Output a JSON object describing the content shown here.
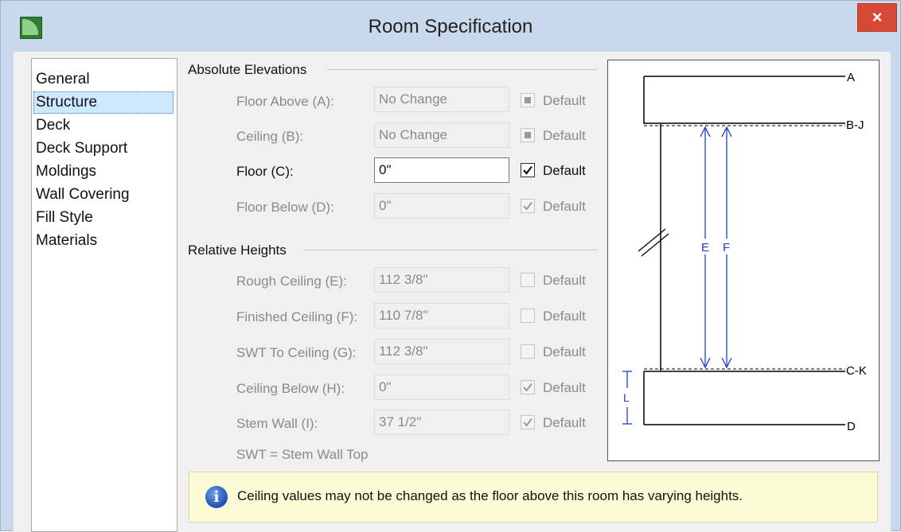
{
  "window": {
    "title": "Room Specification",
    "close_label": "×"
  },
  "nav": {
    "items": [
      "General",
      "Structure",
      "Deck",
      "Deck Support",
      "Moldings",
      "Wall Covering",
      "Fill Style",
      "Materials"
    ],
    "selected_index": 1
  },
  "absolute": {
    "header": "Absolute Elevations",
    "rows": [
      {
        "label": "Floor Above (A):",
        "value": "No Change",
        "default_label": "Default",
        "checkbox": "indeterminate",
        "enabled": false
      },
      {
        "label": "Ceiling (B):",
        "value": "No Change",
        "default_label": "Default",
        "checkbox": "indeterminate",
        "enabled": false
      },
      {
        "label": "Floor (C):",
        "value": "0\"",
        "default_label": "Default",
        "checkbox": "checked",
        "enabled": true
      },
      {
        "label": "Floor Below (D):",
        "value": "0\"",
        "default_label": "Default",
        "checkbox": "checked",
        "enabled": false
      }
    ]
  },
  "relative": {
    "header": "Relative Heights",
    "rows": [
      {
        "label": "Rough Ceiling (E):",
        "value": "112 3/8\"",
        "default_label": "Default",
        "checkbox": "unchecked",
        "enabled": false
      },
      {
        "label": "Finished Ceiling (F):",
        "value": "110 7/8\"",
        "default_label": "Default",
        "checkbox": "unchecked",
        "enabled": false
      },
      {
        "label": "SWT To Ceiling (G):",
        "value": "112 3/8\"",
        "default_label": "Default",
        "checkbox": "unchecked",
        "enabled": false
      },
      {
        "label": "Ceiling Below (H):",
        "value": "0\"",
        "default_label": "Default",
        "checkbox": "checked",
        "enabled": false
      },
      {
        "label": "Stem Wall (I):",
        "value": "37 1/2\"",
        "default_label": "Default",
        "checkbox": "checked",
        "enabled": false
      }
    ],
    "note": "SWT = Stem Wall Top"
  },
  "diagram": {
    "labels": {
      "a": "A",
      "bj": "B-J",
      "ck": "C-K",
      "d": "D",
      "e": "E",
      "f": "F",
      "l": "L"
    }
  },
  "info": {
    "icon": "info-icon",
    "text": "Ceiling values may not be changed as the floor above this room has varying heights."
  },
  "colors": {
    "accent_blue": "#1f3fd0",
    "selection": "#cde8ff",
    "info_bg": "#fbfbd6",
    "close": "#d64937"
  }
}
